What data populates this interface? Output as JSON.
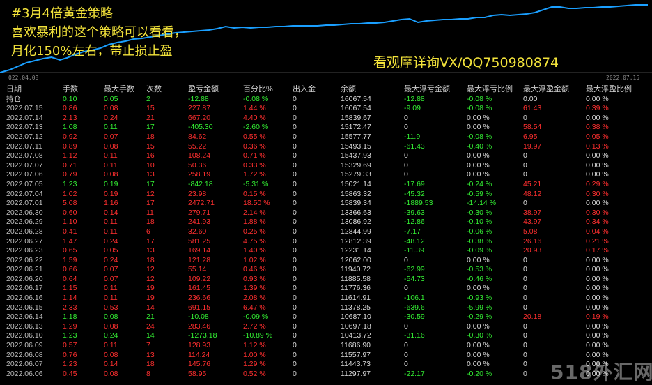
{
  "chart": {
    "caption_lines": [
      "#3月4倍黄金策略",
      "喜欢暴利的这个策略可以看看，",
      "月化150%左右，带止损止盈"
    ],
    "contact": "看观摩详询VX/QQ750980874",
    "date_start": "022.04.08",
    "date_end": "2022.07.15",
    "line_color": "#1a9fff"
  },
  "table": {
    "headers": [
      "日期",
      "手数",
      "最大手数",
      "次数",
      "盈亏金额",
      "百分比%",
      "出入金",
      "余额",
      "最大浮亏金额",
      "最大浮亏比例",
      "最大浮盈金额",
      "最大浮盈比例"
    ],
    "rows": [
      {
        "cells": [
          "持仓",
          "0.10",
          "0.05",
          "2",
          "-12.88",
          "-0.08 %",
          "0",
          "16067.54",
          "-12.88",
          "-0.08 %",
          "0.00",
          "0.00 %"
        ],
        "colors": [
          "w",
          "g",
          "g",
          "g",
          "g",
          "g",
          "w",
          "w",
          "g",
          "g",
          "w",
          "w"
        ],
        "hold": true
      },
      {
        "cells": [
          "2022.07.15",
          "0.86",
          "0.08",
          "15",
          "227.87",
          "1.44 %",
          "0",
          "16067.54",
          "-9.09",
          "-0.08 %",
          "61.43",
          "0.39 %"
        ],
        "colors": [
          "d",
          "r",
          "r",
          "r",
          "r",
          "r",
          "w",
          "w",
          "g",
          "g",
          "r",
          "r"
        ]
      },
      {
        "cells": [
          "2022.07.14",
          "2.13",
          "0.24",
          "21",
          "667.20",
          "4.40 %",
          "0",
          "15839.67",
          "0",
          "0.00 %",
          "0",
          "0.00 %"
        ],
        "colors": [
          "d",
          "r",
          "r",
          "r",
          "r",
          "r",
          "w",
          "w",
          "w",
          "w",
          "w",
          "w"
        ]
      },
      {
        "cells": [
          "2022.07.13",
          "1.08",
          "0.11",
          "17",
          "-405.30",
          "-2.60 %",
          "0",
          "15172.47",
          "0",
          "0.00 %",
          "58.54",
          "0.38 %"
        ],
        "colors": [
          "d",
          "g",
          "g",
          "g",
          "g",
          "g",
          "w",
          "w",
          "w",
          "w",
          "r",
          "r"
        ]
      },
      {
        "cells": [
          "2022.07.12",
          "0.92",
          "0.07",
          "18",
          "84.62",
          "0.55 %",
          "0",
          "15577.77",
          "-11.9",
          "-0.08 %",
          "6.95",
          "0.05 %"
        ],
        "colors": [
          "d",
          "r",
          "r",
          "r",
          "r",
          "r",
          "w",
          "w",
          "g",
          "g",
          "r",
          "r"
        ]
      },
      {
        "cells": [
          "2022.07.11",
          "0.89",
          "0.08",
          "15",
          "55.22",
          "0.36 %",
          "0",
          "15493.15",
          "-61.43",
          "-0.40 %",
          "19.97",
          "0.13 %"
        ],
        "colors": [
          "d",
          "r",
          "r",
          "r",
          "r",
          "r",
          "w",
          "w",
          "g",
          "g",
          "r",
          "r"
        ]
      },
      {
        "cells": [
          "2022.07.08",
          "1.12",
          "0.11",
          "16",
          "108.24",
          "0.71 %",
          "0",
          "15437.93",
          "0",
          "0.00 %",
          "0",
          "0.00 %"
        ],
        "colors": [
          "d",
          "r",
          "r",
          "r",
          "r",
          "r",
          "w",
          "w",
          "w",
          "w",
          "w",
          "w"
        ]
      },
      {
        "cells": [
          "2022.07.07",
          "0.71",
          "0.11",
          "10",
          "50.36",
          "0.33 %",
          "0",
          "15329.69",
          "0",
          "0.00 %",
          "0",
          "0.00 %"
        ],
        "colors": [
          "d",
          "r",
          "r",
          "r",
          "r",
          "r",
          "w",
          "w",
          "w",
          "w",
          "w",
          "w"
        ]
      },
      {
        "cells": [
          "2022.07.06",
          "0.79",
          "0.08",
          "13",
          "258.19",
          "1.72 %",
          "0",
          "15279.33",
          "0",
          "0.00 %",
          "0",
          "0.00 %"
        ],
        "colors": [
          "d",
          "r",
          "r",
          "r",
          "r",
          "r",
          "w",
          "w",
          "w",
          "w",
          "w",
          "w"
        ]
      },
      {
        "cells": [
          "2022.07.05",
          "1.23",
          "0.19",
          "17",
          "-842.18",
          "-5.31 %",
          "0",
          "15021.14",
          "-17.69",
          "-0.24 %",
          "45.21",
          "0.29 %"
        ],
        "colors": [
          "d",
          "g",
          "g",
          "g",
          "g",
          "g",
          "w",
          "w",
          "g",
          "g",
          "r",
          "r"
        ]
      },
      {
        "cells": [
          "2022.07.04",
          "1.02",
          "0.19",
          "12",
          "23.98",
          "0.15 %",
          "0",
          "15863.32",
          "-45.32",
          "-0.59 %",
          "48.12",
          "0.30 %"
        ],
        "colors": [
          "d",
          "r",
          "r",
          "r",
          "r",
          "r",
          "w",
          "w",
          "g",
          "g",
          "r",
          "r"
        ]
      },
      {
        "cells": [
          "2022.07.01",
          "5.08",
          "1.16",
          "17",
          "2472.71",
          "18.50 %",
          "0",
          "15839.34",
          "-1889.53",
          "-14.14 %",
          "0",
          "0.00 %"
        ],
        "colors": [
          "d",
          "r",
          "r",
          "r",
          "r",
          "r",
          "w",
          "w",
          "g",
          "g",
          "w",
          "w"
        ]
      },
      {
        "cells": [
          "2022.06.30",
          "0.60",
          "0.14",
          "11",
          "279.71",
          "2.14 %",
          "0",
          "13366.63",
          "-39.63",
          "-0.30 %",
          "38.97",
          "0.30 %"
        ],
        "colors": [
          "d",
          "r",
          "r",
          "r",
          "r",
          "r",
          "w",
          "w",
          "g",
          "g",
          "r",
          "r"
        ]
      },
      {
        "cells": [
          "2022.06.29",
          "1.10",
          "0.11",
          "18",
          "241.93",
          "1.88 %",
          "0",
          "13086.92",
          "-12.86",
          "-0.10 %",
          "43.97",
          "0.34 %"
        ],
        "colors": [
          "d",
          "r",
          "r",
          "r",
          "r",
          "r",
          "w",
          "w",
          "g",
          "g",
          "r",
          "r"
        ]
      },
      {
        "cells": [
          "2022.06.28",
          "0.41",
          "0.11",
          "6",
          "32.60",
          "0.25 %",
          "0",
          "12844.99",
          "-7.17",
          "-0.06 %",
          "5.08",
          "0.04 %"
        ],
        "colors": [
          "d",
          "r",
          "r",
          "r",
          "r",
          "r",
          "w",
          "w",
          "g",
          "g",
          "r",
          "r"
        ]
      },
      {
        "cells": [
          "2022.06.27",
          "1.47",
          "0.24",
          "17",
          "581.25",
          "4.75 %",
          "0",
          "12812.39",
          "-48.12",
          "-0.38 %",
          "26.16",
          "0.21 %"
        ],
        "colors": [
          "d",
          "r",
          "r",
          "r",
          "r",
          "r",
          "w",
          "w",
          "g",
          "g",
          "r",
          "r"
        ]
      },
      {
        "cells": [
          "2022.06.23",
          "0.65",
          "0.05",
          "13",
          "169.14",
          "1.40 %",
          "0",
          "12231.14",
          "-11.39",
          "-0.09 %",
          "20.93",
          "0.17 %"
        ],
        "colors": [
          "d",
          "r",
          "r",
          "r",
          "r",
          "r",
          "w",
          "w",
          "g",
          "g",
          "r",
          "r"
        ]
      },
      {
        "cells": [
          "2022.06.22",
          "1.59",
          "0.24",
          "18",
          "121.28",
          "1.02 %",
          "0",
          "12062.00",
          "0",
          "0.00 %",
          "0",
          "0.00 %"
        ],
        "colors": [
          "d",
          "r",
          "r",
          "r",
          "r",
          "r",
          "w",
          "w",
          "w",
          "w",
          "w",
          "w"
        ]
      },
      {
        "cells": [
          "2022.06.21",
          "0.66",
          "0.07",
          "12",
          "55.14",
          "0.46 %",
          "0",
          "11940.72",
          "-62.99",
          "-0.53 %",
          "0",
          "0.00 %"
        ],
        "colors": [
          "d",
          "r",
          "r",
          "r",
          "r",
          "r",
          "w",
          "w",
          "g",
          "g",
          "w",
          "w"
        ]
      },
      {
        "cells": [
          "2022.06.20",
          "0.64",
          "0.07",
          "12",
          "109.22",
          "0.93 %",
          "0",
          "11885.58",
          "-54.73",
          "-0.46 %",
          "0",
          "0.00 %"
        ],
        "colors": [
          "d",
          "r",
          "r",
          "r",
          "r",
          "r",
          "w",
          "w",
          "g",
          "g",
          "w",
          "w"
        ]
      },
      {
        "cells": [
          "2022.06.17",
          "1.15",
          "0.11",
          "19",
          "161.45",
          "1.39 %",
          "0",
          "11776.36",
          "0",
          "0.00 %",
          "0",
          "0.00 %"
        ],
        "colors": [
          "d",
          "r",
          "r",
          "r",
          "r",
          "r",
          "w",
          "w",
          "w",
          "w",
          "w",
          "w"
        ]
      },
      {
        "cells": [
          "2022.06.16",
          "1.14",
          "0.11",
          "19",
          "236.66",
          "2.08 %",
          "0",
          "11614.91",
          "-106.1",
          "-0.93 %",
          "0",
          "0.00 %"
        ],
        "colors": [
          "d",
          "r",
          "r",
          "r",
          "r",
          "r",
          "w",
          "w",
          "g",
          "g",
          "w",
          "w"
        ]
      },
      {
        "cells": [
          "2022.06.15",
          "2.33",
          "0.53",
          "14",
          "691.15",
          "6.47 %",
          "0",
          "11378.25",
          "-639.6",
          "-5.99 %",
          "0",
          "0.00 %"
        ],
        "colors": [
          "d",
          "r",
          "r",
          "r",
          "r",
          "r",
          "w",
          "w",
          "g",
          "g",
          "w",
          "w"
        ]
      },
      {
        "cells": [
          "2022.06.14",
          "1.18",
          "0.08",
          "21",
          "-10.08",
          "-0.09 %",
          "0",
          "10687.10",
          "-30.59",
          "-0.29 %",
          "20.18",
          "0.19 %"
        ],
        "colors": [
          "d",
          "g",
          "g",
          "g",
          "g",
          "g",
          "w",
          "w",
          "g",
          "g",
          "r",
          "r"
        ]
      },
      {
        "cells": [
          "2022.06.13",
          "1.29",
          "0.08",
          "24",
          "283.46",
          "2.72 %",
          "0",
          "10697.18",
          "0",
          "0.00 %",
          "0",
          "0.00 %"
        ],
        "colors": [
          "d",
          "r",
          "r",
          "r",
          "r",
          "r",
          "w",
          "w",
          "w",
          "w",
          "w",
          "w"
        ]
      },
      {
        "cells": [
          "2022.06.10",
          "1.23",
          "0.24",
          "14",
          "-1273.18",
          "-10.89 %",
          "0",
          "10413.72",
          "-31.16",
          "-0.30 %",
          "0",
          "0.00 %"
        ],
        "colors": [
          "d",
          "g",
          "g",
          "g",
          "g",
          "g",
          "w",
          "w",
          "g",
          "g",
          "w",
          "w"
        ]
      },
      {
        "cells": [
          "2022.06.09",
          "0.57",
          "0.11",
          "7",
          "128.93",
          "1.12 %",
          "0",
          "11686.90",
          "0",
          "0.00 %",
          "0",
          "0.00 %"
        ],
        "colors": [
          "d",
          "r",
          "r",
          "r",
          "r",
          "r",
          "w",
          "w",
          "w",
          "w",
          "w",
          "w"
        ]
      },
      {
        "cells": [
          "2022.06.08",
          "0.76",
          "0.08",
          "13",
          "114.24",
          "1.00 %",
          "0",
          "11557.97",
          "0",
          "0.00 %",
          "0",
          "0.00 %"
        ],
        "colors": [
          "d",
          "r",
          "r",
          "r",
          "r",
          "r",
          "w",
          "w",
          "w",
          "w",
          "w",
          "w"
        ]
      },
      {
        "cells": [
          "2022.06.07",
          "1.23",
          "0.14",
          "18",
          "145.76",
          "1.29 %",
          "0",
          "11443.73",
          "0",
          "0.00 %",
          "0",
          "0.00 %"
        ],
        "colors": [
          "d",
          "r",
          "r",
          "r",
          "r",
          "r",
          "w",
          "w",
          "w",
          "w",
          "w",
          "w"
        ]
      },
      {
        "cells": [
          "2022.06.06",
          "0.45",
          "0.08",
          "8",
          "58.95",
          "0.52 %",
          "0",
          "11297.97",
          "-22.17",
          "-0.20 %",
          "0",
          "0.00 %"
        ],
        "colors": [
          "d",
          "r",
          "r",
          "r",
          "r",
          "r",
          "w",
          "w",
          "g",
          "g",
          "w",
          "w"
        ]
      }
    ]
  },
  "watermark": "518外汇网"
}
